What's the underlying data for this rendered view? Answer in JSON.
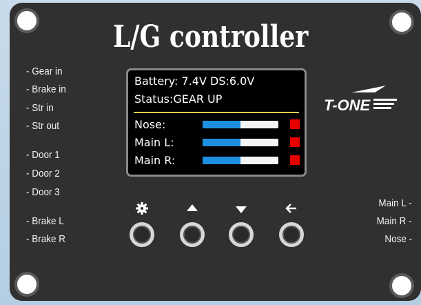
{
  "title": "L/G controller",
  "left_labels": [
    "- Gear in",
    "- Brake in",
    "- Str in",
    "- Str out",
    "- Door 1",
    "- Door 2",
    "- Door 3",
    "- Brake L",
    "- Brake R"
  ],
  "right_labels": [
    "Main L  -",
    "Main R -",
    "Nose   -"
  ],
  "logo_text": "T-ONE",
  "screen": {
    "battery_line": "Battery: 7.4V DS:6.0V",
    "status_line": "Status:GEAR UP",
    "gears": [
      {
        "label": "Nose:",
        "level": 0.5,
        "indicator_color": "#e60000"
      },
      {
        "label": "Main L:",
        "level": 0.5,
        "indicator_color": "#e60000"
      },
      {
        "label": "Main R:",
        "level": 0.5,
        "indicator_color": "#e60000"
      }
    ]
  },
  "buttons": [
    {
      "icon": "gear-icon"
    },
    {
      "icon": "up-arrow-icon"
    },
    {
      "icon": "down-arrow-icon"
    },
    {
      "icon": "back-arrow-icon"
    }
  ],
  "colors": {
    "panel": "#303030",
    "bar_fill": "#1e8fe0",
    "indicator": "#e60000",
    "divider": "#e8d24a"
  }
}
